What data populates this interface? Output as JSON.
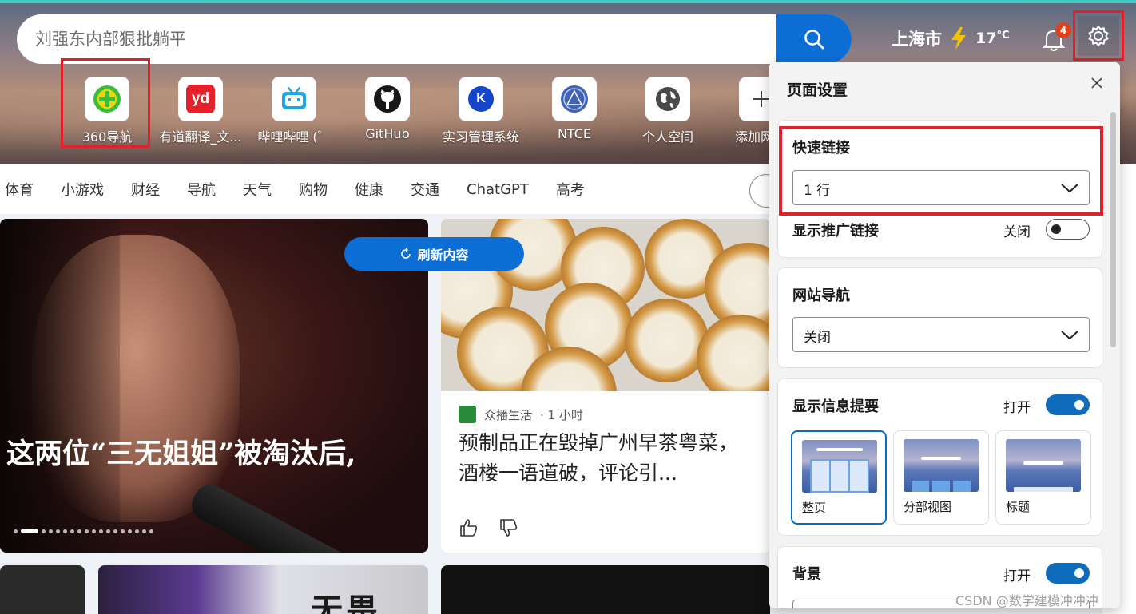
{
  "search": {
    "placeholder": "刘强东内部狠批躺平"
  },
  "weather": {
    "city": "上海市",
    "temperature": "17",
    "unit": "°C"
  },
  "notifications": {
    "count": "4"
  },
  "quick_links": [
    {
      "label": "360导航",
      "icon": "360-nav-icon"
    },
    {
      "label": "有道翻译_文...",
      "icon": "youdao-icon"
    },
    {
      "label": "哔哩哔哩 (゜",
      "icon": "bilibili-icon"
    },
    {
      "label": "GitHub",
      "icon": "github-icon"
    },
    {
      "label": "实习管理系统",
      "icon": "k-icon"
    },
    {
      "label": "NTCE",
      "icon": "ntce-icon"
    },
    {
      "label": "个人空间",
      "icon": "globe-icon"
    },
    {
      "label": "添加网站",
      "icon": "plus-icon"
    }
  ],
  "nav": {
    "items": [
      "体育",
      "小游戏",
      "财经",
      "导航",
      "天气",
      "购物",
      "健康",
      "交通",
      "ChatGPT",
      "高考"
    ]
  },
  "feed": {
    "refresh_label": "刷新内容",
    "hero_title": "这两位“三无姐姐”被淘汰后,",
    "card": {
      "source": "众播生活",
      "time": "· 1 小时",
      "title": "预制品正在毁掉广州早茶粤菜，酒楼一语道破，评论引..."
    },
    "bottom_text": "无畏"
  },
  "settings": {
    "title": "页面设置",
    "quick_links": {
      "label": "快速链接",
      "value": "1 行"
    },
    "promoted_links": {
      "label": "显示推广链接",
      "state_label": "关闭",
      "on": false
    },
    "site_nav": {
      "label": "网站导航",
      "value": "关闭"
    },
    "info_summary": {
      "label": "显示信息提要",
      "state_label": "打开",
      "on": true
    },
    "layouts": [
      "整页",
      "分部视图",
      "标题"
    ],
    "background": {
      "label": "背景",
      "state_label": "打开",
      "on": true
    }
  },
  "watermark": "CSDN @数学建模冲冲冲",
  "colors": {
    "accent": "#0d6fd6",
    "highlight": "#e0202a",
    "toggle_on": "#0f6cbd"
  }
}
